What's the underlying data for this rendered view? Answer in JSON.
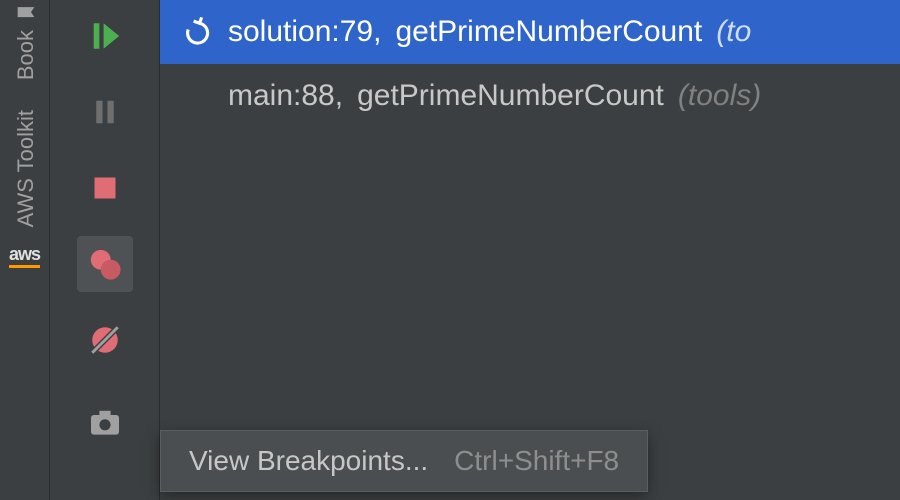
{
  "rail": {
    "bookmarks_label": "Book",
    "aws_label": "AWS Toolkit",
    "aws_logo_text": "aws"
  },
  "debug_toolbar": {
    "resume": "resume",
    "pause": "pause",
    "stop": "stop",
    "breakpoints": "breakpoints",
    "mute": "mute-breakpoints",
    "camera": "snapshot"
  },
  "frames": [
    {
      "location": "solution:79,",
      "method": "getPrimeNumberCount",
      "package": "(to",
      "selected": true
    },
    {
      "location": "main:88,",
      "method": "getPrimeNumberCount",
      "package": "(tools)",
      "selected": false
    }
  ],
  "tooltip": {
    "label": "View Breakpoints...",
    "shortcut": "Ctrl+Shift+F8"
  }
}
